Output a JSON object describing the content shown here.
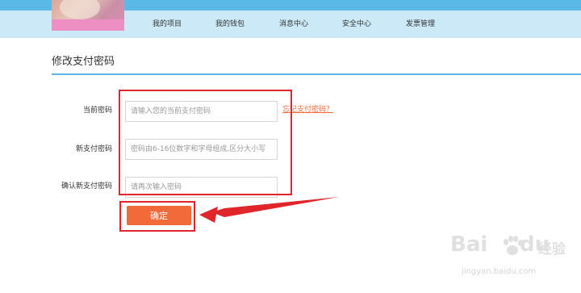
{
  "header": {
    "nav_items": [
      "我的项目",
      "我的钱包",
      "消息中心",
      "安全中心",
      "发票管理"
    ]
  },
  "page": {
    "title": "修改支付密码"
  },
  "form": {
    "current": {
      "label": "当前密码",
      "placeholder": "请输入您的当前支付密码",
      "value": ""
    },
    "new": {
      "label": "新支付密码",
      "placeholder": "密码由6-16位数字和字母组成,区分大小写",
      "value": ""
    },
    "confirm": {
      "label": "确认新支付密码",
      "placeholder": "请再次输入密码",
      "value": ""
    },
    "forgot_link": "忘记支付密码？",
    "submit_label": "确定"
  },
  "watermark": {
    "brand": "Bai",
    "brand_suffix": "du",
    "sub": "经验",
    "url": "jingyan.baidu.com"
  },
  "colors": {
    "header_top": "#5bb9e8",
    "header_nav": "#cce9f7",
    "accent": "#f26a3a",
    "annotation": "#e0252b"
  }
}
